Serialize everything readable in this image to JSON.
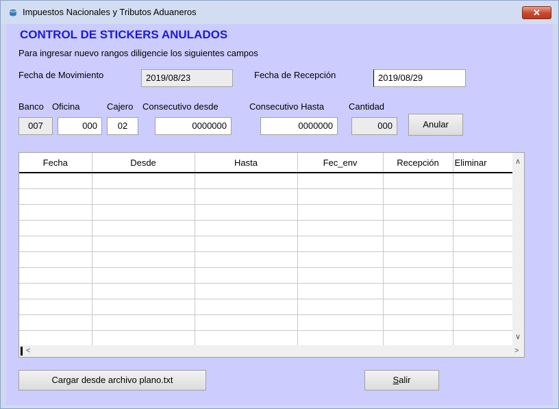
{
  "window": {
    "title": "Impuestos Nacionales y Tributos Aduaneros",
    "close_glyph": "✕"
  },
  "header": {
    "heading": "CONTROL DE STICKERS ANULADOS",
    "instructions": "Para ingresar nuevo rangos diligencie los siguientes campos"
  },
  "dates": {
    "movimiento_label": "Fecha de Movimiento",
    "movimiento_value": "2019/08/23",
    "recepcion_label": "Fecha de Recepción",
    "recepcion_value": "2019/08/29"
  },
  "range": {
    "banco_label": "Banco",
    "banco_value": "007",
    "oficina_label": "Oficina",
    "oficina_value": "000",
    "cajero_label": "Cajero",
    "cajero_value": "02",
    "desde_label": "Consecutivo desde",
    "desde_value": "0000000",
    "hasta_label": "Consecutivo Hasta",
    "hasta_value": "0000000",
    "cantidad_label": "Cantidad",
    "cantidad_value": "000",
    "anular_label": "Anular"
  },
  "grid": {
    "columns": [
      "Fecha",
      "Desde",
      "Hasta",
      "Fec_env",
      "Recepción",
      "Eliminar"
    ]
  },
  "footer": {
    "load_label": "Cargar desde archivo plano.txt",
    "exit_label_first": "S",
    "exit_label_rest": "alir"
  },
  "icons": {
    "up": "∧",
    "down": "∨",
    "left": "<",
    "right": ">"
  }
}
